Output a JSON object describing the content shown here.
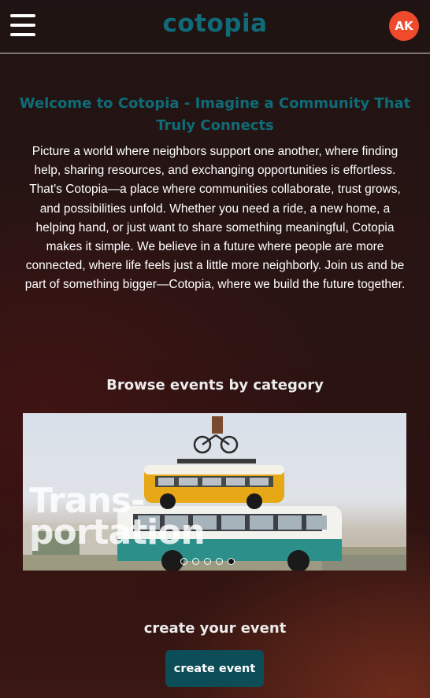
{
  "header": {
    "logo": "cotopia",
    "avatar_initials": "AK",
    "menu_icon": "hamburger-menu-icon"
  },
  "welcome": {
    "title": "Welcome to Cotopia - Imagine a Community That Truly Connects",
    "text": "Picture a world where neighbors support one another, where finding help, sharing resources, and exchanging opportunities is effortless. That's Cotopia—a place where communities collaborate, trust grows, and possibilities unfold. Whether you need a ride, a new home, a helping hand, or just want to share something meaningful, Cotopia makes it simple. We believe in a future where people are more connected, where life feels just a little more neighborly. Join us and be part of something bigger—Cotopia, where we build the future together."
  },
  "browse": {
    "title": "Browse events by category",
    "slide_label": "Transportation",
    "slide_label_line1": "Trans-",
    "slide_label_line2": "portation",
    "dot_count": 5,
    "active_dot_index": 4
  },
  "create": {
    "title": "create your event",
    "button_label": "create event"
  },
  "colors": {
    "brand_teal": "#0e6b77",
    "button_bg": "#0d4d58",
    "avatar_bg": "#f04a2c"
  }
}
